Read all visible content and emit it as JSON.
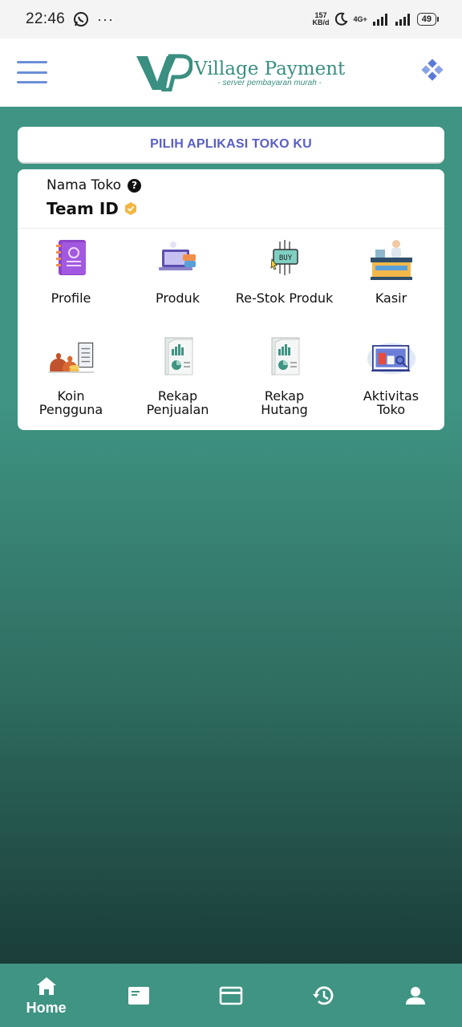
{
  "status_bar": {
    "time": "22:46",
    "net_speed_value": "157",
    "net_speed_unit": "KB/d",
    "network_type": "4G+",
    "battery": "49"
  },
  "header": {
    "brand_title": "Village Payment",
    "brand_subtitle": "- server pembayaran murah -",
    "brand_mark": "VP"
  },
  "pilih_button": {
    "label": "PILIH APLIKASI TOKO KU"
  },
  "store": {
    "label": "Nama Toko",
    "name": "Team ID"
  },
  "menu": [
    {
      "label": "Profile",
      "icon": "notebook-icon"
    },
    {
      "label": "Produk",
      "icon": "laptop-products-icon"
    },
    {
      "label": "Re-Stok Produk",
      "icon": "buy-chip-icon"
    },
    {
      "label": "Kasir",
      "icon": "cashier-icon"
    },
    {
      "label": "Koin Pengguna",
      "icon": "money-bag-icon"
    },
    {
      "label": "Rekap Penjualan",
      "icon": "report-chart-icon"
    },
    {
      "label": "Rekap Hutang",
      "icon": "report-chart-icon"
    },
    {
      "label": "Aktivitas Toko",
      "icon": "analytics-icon"
    }
  ],
  "bottom_nav": [
    {
      "label": "Home",
      "icon": "home-icon",
      "active": true
    },
    {
      "label": "",
      "icon": "card-icon"
    },
    {
      "label": "",
      "icon": "credit-card-icon"
    },
    {
      "label": "",
      "icon": "history-icon"
    },
    {
      "label": "",
      "icon": "person-icon"
    }
  ],
  "colors": {
    "primary": "#3f9483",
    "accent_text": "#5a5fc4",
    "verified": "#f4b63f"
  }
}
